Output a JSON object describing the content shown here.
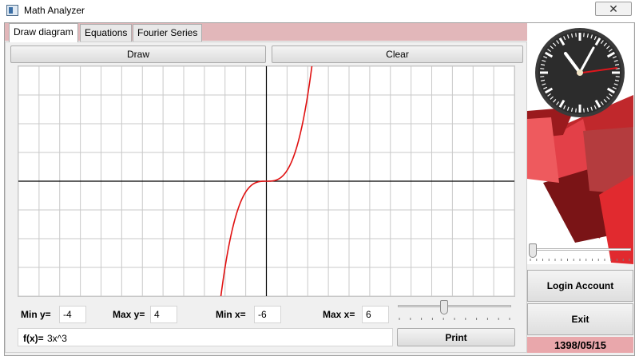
{
  "window": {
    "title": "Math Analyzer",
    "close_label": "✕"
  },
  "tabs": [
    {
      "label": "Draw diagram",
      "active": true
    },
    {
      "label": "Equations",
      "active": false
    },
    {
      "label": "Fourier Series",
      "active": false
    }
  ],
  "toolbar": {
    "draw_label": "Draw",
    "clear_label": "Clear"
  },
  "range": {
    "min_y_label": "Min y=",
    "min_y_value": "-4",
    "max_y_label": "Max y=",
    "max_y_value": "4",
    "min_x_label": "Min x=",
    "min_x_value": "-6",
    "max_x_label": "Max x=",
    "max_x_value": "6"
  },
  "zoom_slider": {
    "level": 0.4
  },
  "function": {
    "label": "f(x)=",
    "value": "3x^3"
  },
  "print_label": "Print",
  "side": {
    "slider_level": 0.0,
    "login_label": "Login Account",
    "exit_label": "Exit",
    "date": "1398/05/15"
  },
  "plot": {
    "x_range": [
      -6,
      6
    ],
    "y_range": [
      -4,
      4
    ],
    "curve_color": "#e01010"
  },
  "colors": {
    "accent_red": "#d9242b",
    "tab_strip": "#e2b7ba",
    "date_bg": "#e9a7ab"
  }
}
